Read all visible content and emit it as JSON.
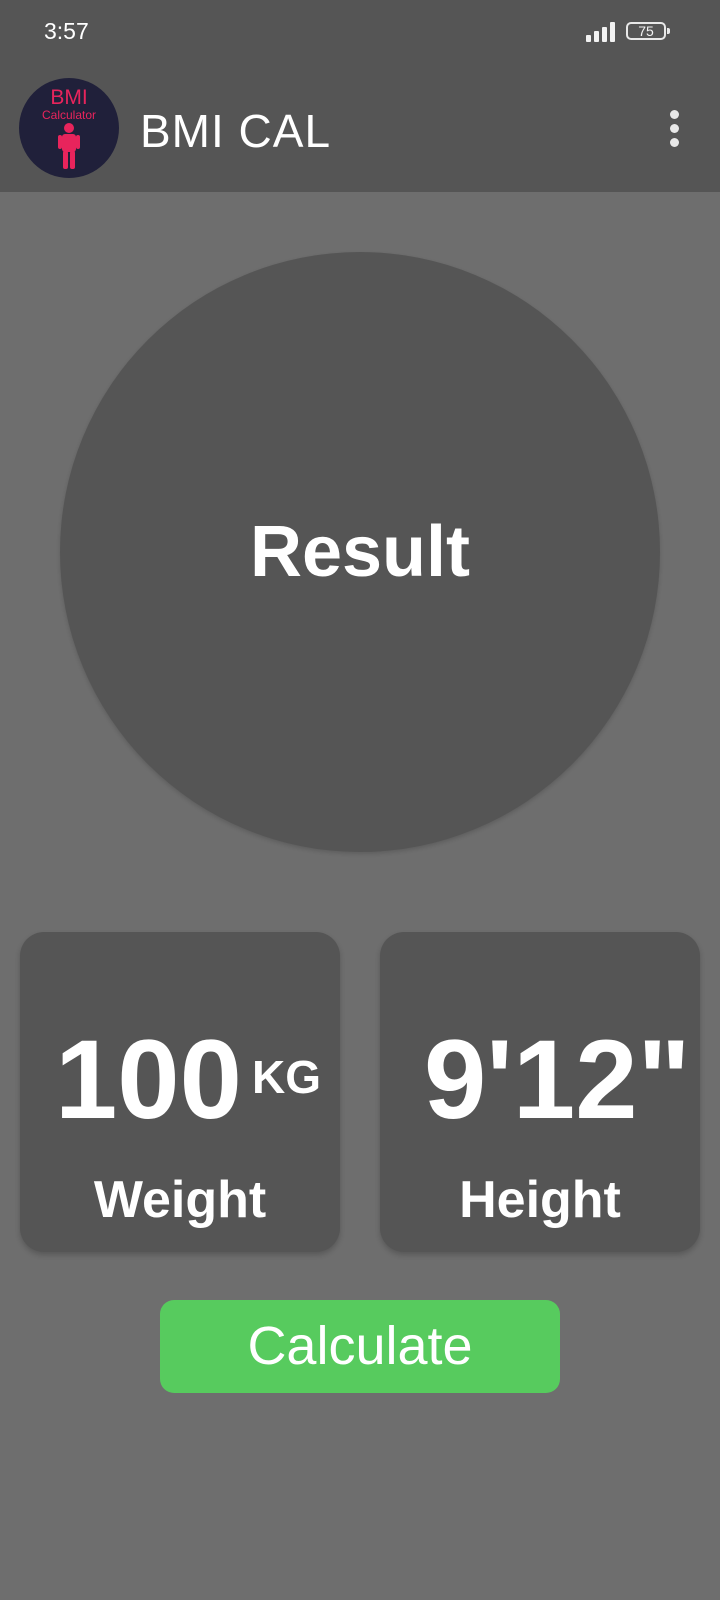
{
  "status_bar": {
    "time": "3:57",
    "battery": "75"
  },
  "app_bar": {
    "title": "BMI CAL",
    "logo_line1": "BMI",
    "logo_line2": "Calculator",
    "logo_color": "#e8245c"
  },
  "result": {
    "label": "Result"
  },
  "weight": {
    "value": "100",
    "unit": "KG",
    "label": "Weight"
  },
  "height": {
    "value": "9'12\"",
    "label": "Height"
  },
  "calculate": {
    "label": "Calculate",
    "color": "#57cb5e"
  },
  "icons": [
    "signal-icon",
    "battery-icon",
    "overflow-menu-icon",
    "app-logo"
  ]
}
